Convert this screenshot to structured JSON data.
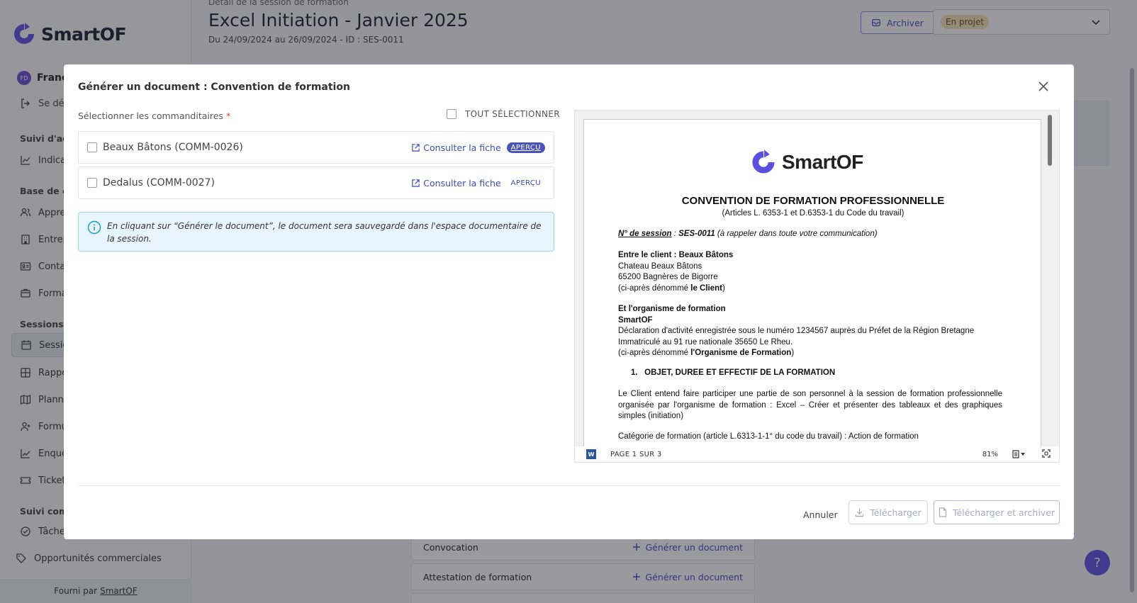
{
  "app": {
    "name": "SmartOF",
    "colors": {
      "brand": "#5b4fe0",
      "accent": "#4b44c4",
      "status_pill": "#f3e3b8",
      "info_bg": "#e6f6fc"
    }
  },
  "sidebar": {
    "user": {
      "initials": "FD",
      "name": "Franc"
    },
    "logout_label": "Se déc",
    "sections": [
      {
        "title": "Suivi d'acti",
        "items": [
          {
            "label": "Indicat",
            "icon": "chart-icon"
          }
        ]
      },
      {
        "title": "Base de co",
        "items": [
          {
            "label": "Appren",
            "icon": "users-icon"
          },
          {
            "label": "Entrep",
            "icon": "building-icon"
          },
          {
            "label": "Conta",
            "icon": "contact-card-icon"
          },
          {
            "label": "Forma",
            "icon": "graduation-icon"
          }
        ]
      },
      {
        "title": "Sessions",
        "items": [
          {
            "label": "Sessio",
            "icon": "calendar-icon"
          },
          {
            "label": "Rappo",
            "icon": "grid-icon"
          },
          {
            "label": "Plannin",
            "icon": "map-icon"
          },
          {
            "label": "Formu",
            "icon": "user-plus-icon"
          },
          {
            "label": "Enquê",
            "icon": "trend-icon"
          },
          {
            "label": "Ticket",
            "icon": "ticket-icon"
          }
        ]
      },
      {
        "title": "Suivi comm",
        "items": [
          {
            "label": "Tâches",
            "icon": "check-circle-icon"
          },
          {
            "label": "Opportunités commerciales",
            "icon": "tag-icon"
          }
        ]
      }
    ],
    "footer": {
      "prefix": "Fourni par",
      "link": "SmartOF"
    }
  },
  "header": {
    "breadcrumb": "Détail de la session de formation",
    "title": "Excel Initiation - Janvier 2025",
    "subtitle": "Du 24/09/2024 au 26/09/2024 - ID : SES-0011",
    "archive_label": "Archiver",
    "status_value": "En projet"
  },
  "background_docs": [
    {
      "label": "Convocation",
      "action": "Générer un document"
    },
    {
      "label": "Attestation de formation",
      "action": "Générer un document"
    }
  ],
  "help_label": "?",
  "modal": {
    "title": "Générer un document : Convention de formation",
    "select_label": "Sélectionner les commanditaires",
    "required_mark": "*",
    "select_all_label": "TOUT SÉLECTIONNER",
    "clients": [
      {
        "name": "Beaux Bâtons (COMM-0026)",
        "consult_label": "Consulter la fiche",
        "preview_label": "APERÇU",
        "preview_active": true
      },
      {
        "name": "Dedalus (COMM-0027)",
        "consult_label": "Consulter la fiche",
        "preview_label": "APERÇU",
        "preview_active": false
      }
    ],
    "info_text": "En cliquant sur “Générer le document”, le document sera sauvegardé dans l'espace documentaire de la session.",
    "preview": {
      "logo_text": "SmartOF",
      "doc_title": "CONVENTION DE FORMATION PROFESSIONNELLE",
      "doc_subtitle": "(Articles L. 6353-1 et D.6353-1 du Code du travail)",
      "session_label": "N° de session",
      "session_sep": " : ",
      "session_id": "SES-0011",
      "session_note": " (à rappeler dans toute votre communication)",
      "client_heading": "Entre le client : Beaux Bâtons",
      "client_lines": [
        "Chateau Beaux Bâtons",
        "65200 Bagnères de Bigorre"
      ],
      "client_designation_pre": "(ci-après dénommé ",
      "client_designation_bold": "le Client",
      "designation_post": ")",
      "org_heading": "Et l'organisme de formation",
      "org_name": "SmartOF",
      "org_lines": [
        "Déclaration d'activité enregistrée sous le numéro 1234567 auprès du Préfet de la Région Bretagne",
        "Immatriculé au 91 rue nationale 35650 Le Rheu."
      ],
      "org_designation_pre": "(ci-après dénommé ",
      "org_designation_bold": "l'Organisme de Formation",
      "section1_title": "1.   OBJET, DUREE ET EFFECTIF DE LA FORMATION",
      "section1_text": "Le Client entend faire participer une partie de son personnel à la session de formation professionnelle organisée par l'organisme de formation : Excel – Créer et présenter des tableaux et des graphiques simples (initiation)",
      "category_text": "Catégorie de formation (article L.6313-1-1° du code du travail) : Action de formation",
      "page_indicator": "PAGE 1 SUR 3",
      "zoom": "81%",
      "word_badge": "W"
    },
    "buttons": {
      "cancel": "Annuler",
      "download": "Télécharger",
      "download_archive": "Télécharger et archiver"
    }
  }
}
